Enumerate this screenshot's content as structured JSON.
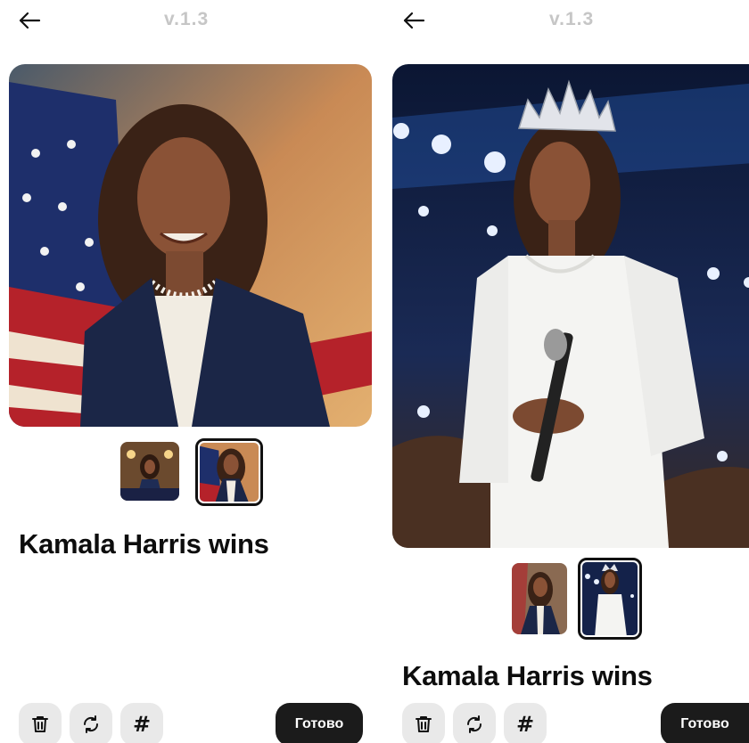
{
  "screens": [
    {
      "version": "v.1.3",
      "title": "Kamala Harris wins",
      "done_label": "Готово",
      "main_image": "portrait-navy-suit-flag",
      "thumbnails": [
        {
          "name": "podium-portrait",
          "selected": false
        },
        {
          "name": "flag-portrait",
          "selected": true
        }
      ]
    },
    {
      "version": "v.1.3",
      "title": "Kamala Harris wins",
      "done_label": "Готово",
      "main_image": "portrait-white-suit-tiara",
      "thumbnails": [
        {
          "name": "navy-suit-portrait",
          "selected": false
        },
        {
          "name": "white-suit-portrait",
          "selected": true
        }
      ]
    }
  ],
  "icons": {
    "back": "arrow-left-icon",
    "delete": "trash-icon",
    "regenerate": "refresh-icon",
    "tags": "hash-icon",
    "hash_glyph": "#"
  },
  "colors": {
    "version_text": "#c6c6c6",
    "tool_button_bg": "#e9e9e9",
    "done_button_bg": "#1b1b1b",
    "selected_thumb_border": "#111111"
  }
}
